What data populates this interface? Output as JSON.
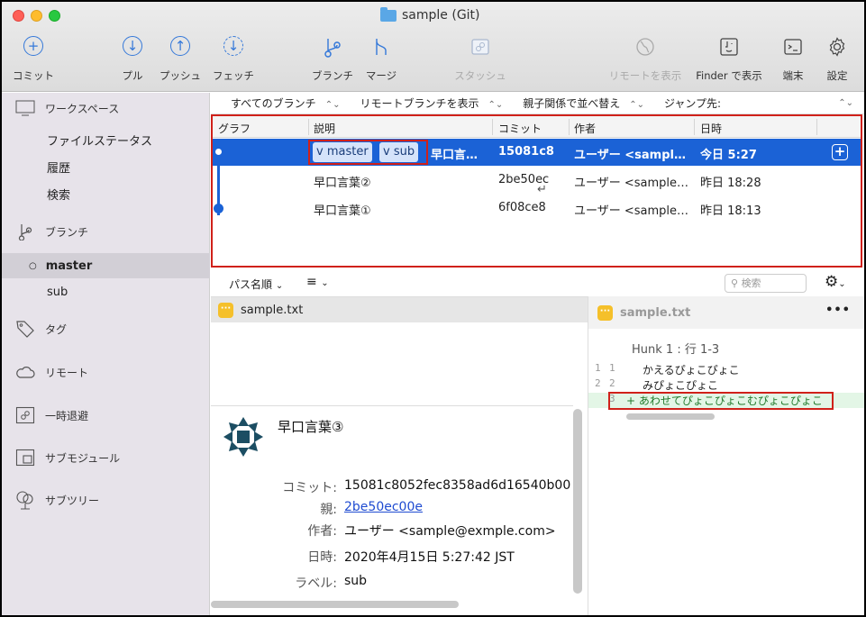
{
  "window": {
    "title": "sample (Git)"
  },
  "toolbar": {
    "commit": "コミット",
    "pull": "プル",
    "push": "プッシュ",
    "fetch": "フェッチ",
    "branch": "ブランチ",
    "merge": "マージ",
    "stash": "スタッシュ",
    "show_remote": "リモートを表示",
    "show_in_finder": "Finder で表示",
    "terminal": "端末",
    "settings": "設定"
  },
  "sidebar": {
    "workspace": "ワークスペース",
    "file_status": "ファイルステータス",
    "history": "履歴",
    "search": "検索",
    "branches": "ブランチ",
    "branch_items": [
      "master",
      "sub"
    ],
    "tags": "タグ",
    "remotes": "リモート",
    "stashes": "一時退避",
    "submodules": "サブモジュール",
    "subtrees": "サブツリー"
  },
  "filter": {
    "all_branches": "すべてのブランチ",
    "show_remote_branches": "リモートブランチを表示",
    "sort_parent": "親子関係で並べ替え",
    "jump_to": "ジャンプ先:"
  },
  "columns": {
    "graph": "グラフ",
    "description": "説明",
    "commit": "コミット",
    "author": "作者",
    "date": "日時"
  },
  "commits": [
    {
      "branch_tags": [
        "master",
        "sub"
      ],
      "description": "早口言…",
      "hash": "15081c8",
      "author": "ユーザー <sampl…",
      "date": "今日 5:27"
    },
    {
      "description": "早口言葉②",
      "hash": "2be50ec",
      "author": "ユーザー <sample…",
      "date": "昨日 18:28"
    },
    {
      "description": "早口言葉①",
      "hash": "6f08ce8",
      "author": "ユーザー <sample…",
      "date": "昨日 18:13"
    }
  ],
  "files_toolbar": {
    "sort": "パス名順",
    "search_placeholder": "検索"
  },
  "files": [
    "sample.txt"
  ],
  "detail": {
    "subject": "早口言葉③",
    "commit_label": "コミット:",
    "commit": "15081c8052fec8358ad6d16540b00",
    "parent_label": "親:",
    "parent": "2be50ec00e",
    "author_label": "作者:",
    "author": "ユーザー <sample@exmple.com>",
    "date_label": "日時:",
    "date": "2020年4月15日 5:27:42 JST",
    "labels_label": "ラベル:",
    "labels": "sub"
  },
  "diff": {
    "file": "sample.txt",
    "hunk": "Hunk 1 : 行 1-3",
    "lines": [
      {
        "old": "1",
        "new": "1",
        "text": "かえるぴょこぴょこ"
      },
      {
        "old": "2",
        "new": "2",
        "text": "みぴょこぴょこ"
      },
      {
        "old": "",
        "new": "3",
        "text": "+ あわせてぴょこぴょこむぴょこぴょこ"
      }
    ]
  }
}
